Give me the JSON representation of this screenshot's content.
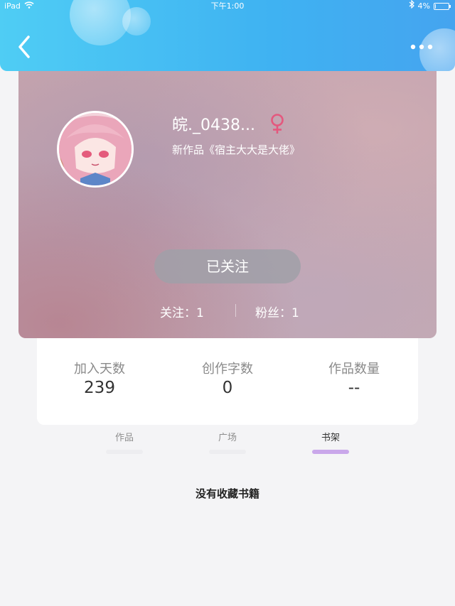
{
  "status_bar": {
    "device": "iPad",
    "time": "下午1:00",
    "battery": "4%",
    "battery_level": 0.04
  },
  "profile": {
    "username": "皖._0438...",
    "gender": "female",
    "new_work": "新作品《宿主大大是大佬》",
    "follow_button": "已关注",
    "following": "关注：1",
    "fans": "粉丝：1"
  },
  "stats": [
    {
      "label": "加入天数",
      "value": "239"
    },
    {
      "label": "创作字数",
      "value": "0"
    },
    {
      "label": "作品数量",
      "value": "--"
    }
  ],
  "tabs": [
    {
      "label": "作品",
      "active": false
    },
    {
      "label": "广场",
      "active": false
    },
    {
      "label": "书架",
      "active": true
    }
  ],
  "empty_message": "没有收藏书籍",
  "colors": {
    "header_start": "#4fcdf4",
    "header_end": "#45a4ef",
    "gender_icon": "#e4587e",
    "active_tab_indicator": "#c9a7ea"
  }
}
